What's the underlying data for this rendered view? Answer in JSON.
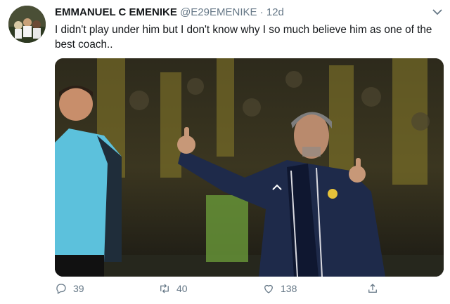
{
  "tweet": {
    "author_name": "EMMANUEL C EMENIKE",
    "author_handle": "@E29EMENIKE",
    "separator": "·",
    "time": "12d",
    "text": "I didn't play under him but I don't know why I so much believe him as one of the best coach..",
    "media": {
      "description_icon": "photo"
    }
  },
  "actions": {
    "replies": "39",
    "retweets": "40",
    "likes": "138"
  },
  "icons": {
    "reply": "reply-icon",
    "retweet": "retweet-icon",
    "like": "heart-icon",
    "share": "share-icon",
    "more": "chevron-down-icon"
  },
  "colors": {
    "secondary_text": "#657786",
    "primary_text": "#14171a"
  }
}
